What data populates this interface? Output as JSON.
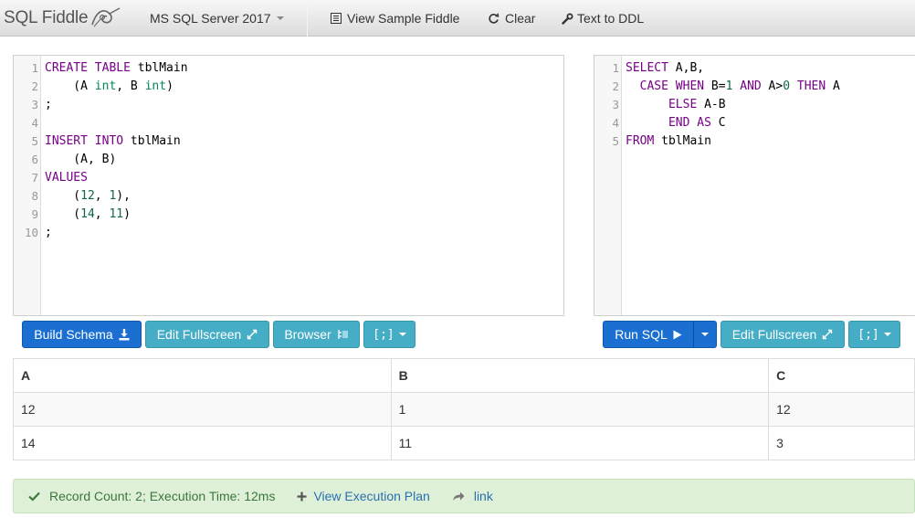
{
  "navbar": {
    "brand": "SQL Fiddle",
    "db_version": "MS SQL Server 2017",
    "view_sample": "View Sample Fiddle",
    "clear": "Clear",
    "text_to_ddl": "Text to DDL"
  },
  "schema_editor": {
    "lines": [
      {
        "n": "1",
        "code": [
          {
            "t": "CREATE TABLE",
            "c": "kw"
          },
          {
            "t": " tblMain",
            "c": ""
          }
        ]
      },
      {
        "n": "2",
        "code": [
          {
            "t": "    (A ",
            "c": ""
          },
          {
            "t": "int",
            "c": "ty"
          },
          {
            "t": ", B ",
            "c": ""
          },
          {
            "t": "int",
            "c": "ty"
          },
          {
            "t": ")",
            "c": ""
          }
        ]
      },
      {
        "n": "3",
        "code": [
          {
            "t": ";",
            "c": ""
          }
        ]
      },
      {
        "n": "4",
        "code": []
      },
      {
        "n": "5",
        "code": [
          {
            "t": "INSERT INTO",
            "c": "kw"
          },
          {
            "t": " tblMain",
            "c": ""
          }
        ]
      },
      {
        "n": "6",
        "code": [
          {
            "t": "    (A, B)",
            "c": ""
          }
        ]
      },
      {
        "n": "7",
        "code": [
          {
            "t": "VALUES",
            "c": "kw"
          }
        ]
      },
      {
        "n": "8",
        "code": [
          {
            "t": "    (",
            "c": ""
          },
          {
            "t": "12",
            "c": "nm"
          },
          {
            "t": ", ",
            "c": ""
          },
          {
            "t": "1",
            "c": "nm"
          },
          {
            "t": "),",
            "c": ""
          }
        ]
      },
      {
        "n": "9",
        "code": [
          {
            "t": "    (",
            "c": ""
          },
          {
            "t": "14",
            "c": "nm"
          },
          {
            "t": ", ",
            "c": ""
          },
          {
            "t": "11",
            "c": "nm"
          },
          {
            "t": ")",
            "c": ""
          }
        ]
      },
      {
        "n": "10",
        "code": [
          {
            "t": ";",
            "c": ""
          }
        ]
      }
    ]
  },
  "query_editor": {
    "lines": [
      {
        "n": "1",
        "code": [
          {
            "t": "SELECT",
            "c": "kw"
          },
          {
            "t": " A,B,",
            "c": ""
          }
        ]
      },
      {
        "n": "2",
        "code": [
          {
            "t": "  ",
            "c": ""
          },
          {
            "t": "CASE WHEN",
            "c": "kw"
          },
          {
            "t": " B=",
            "c": ""
          },
          {
            "t": "1",
            "c": "nm"
          },
          {
            "t": " ",
            "c": ""
          },
          {
            "t": "AND",
            "c": "kw"
          },
          {
            "t": " A>",
            "c": ""
          },
          {
            "t": "0",
            "c": "nm"
          },
          {
            "t": " ",
            "c": ""
          },
          {
            "t": "THEN",
            "c": "kw"
          },
          {
            "t": " A",
            "c": ""
          }
        ]
      },
      {
        "n": "3",
        "code": [
          {
            "t": "      ",
            "c": ""
          },
          {
            "t": "ELSE",
            "c": "kw"
          },
          {
            "t": " A-B",
            "c": ""
          }
        ]
      },
      {
        "n": "4",
        "code": [
          {
            "t": "      ",
            "c": ""
          },
          {
            "t": "END AS",
            "c": "kw"
          },
          {
            "t": " C",
            "c": ""
          }
        ]
      },
      {
        "n": "5",
        "code": [
          {
            "t": "FROM",
            "c": "kw"
          },
          {
            "t": " tblMain",
            "c": ""
          }
        ]
      }
    ]
  },
  "buttons": {
    "build_schema": "Build Schema",
    "edit_fullscreen": "Edit Fullscreen",
    "browser": "Browser",
    "delimiter": "[;]",
    "run_sql": "Run SQL",
    "edit_fullscreen_right": "Edit Fullscreen",
    "delimiter_right": "[;]"
  },
  "results": {
    "headers": [
      "A",
      "B",
      "C"
    ],
    "rows": [
      [
        "12",
        "1",
        "12"
      ],
      [
        "14",
        "11",
        "3"
      ]
    ]
  },
  "status": {
    "record_info": "Record Count: 2; Execution Time: 12ms",
    "view_plan": "View Execution Plan",
    "link": "link"
  },
  "colors": {
    "primary": "#1a6fd1",
    "info": "#45adc6",
    "keyword": "#770088",
    "type": "#008855",
    "number": "#116644",
    "success_bg": "#dff0d8"
  }
}
